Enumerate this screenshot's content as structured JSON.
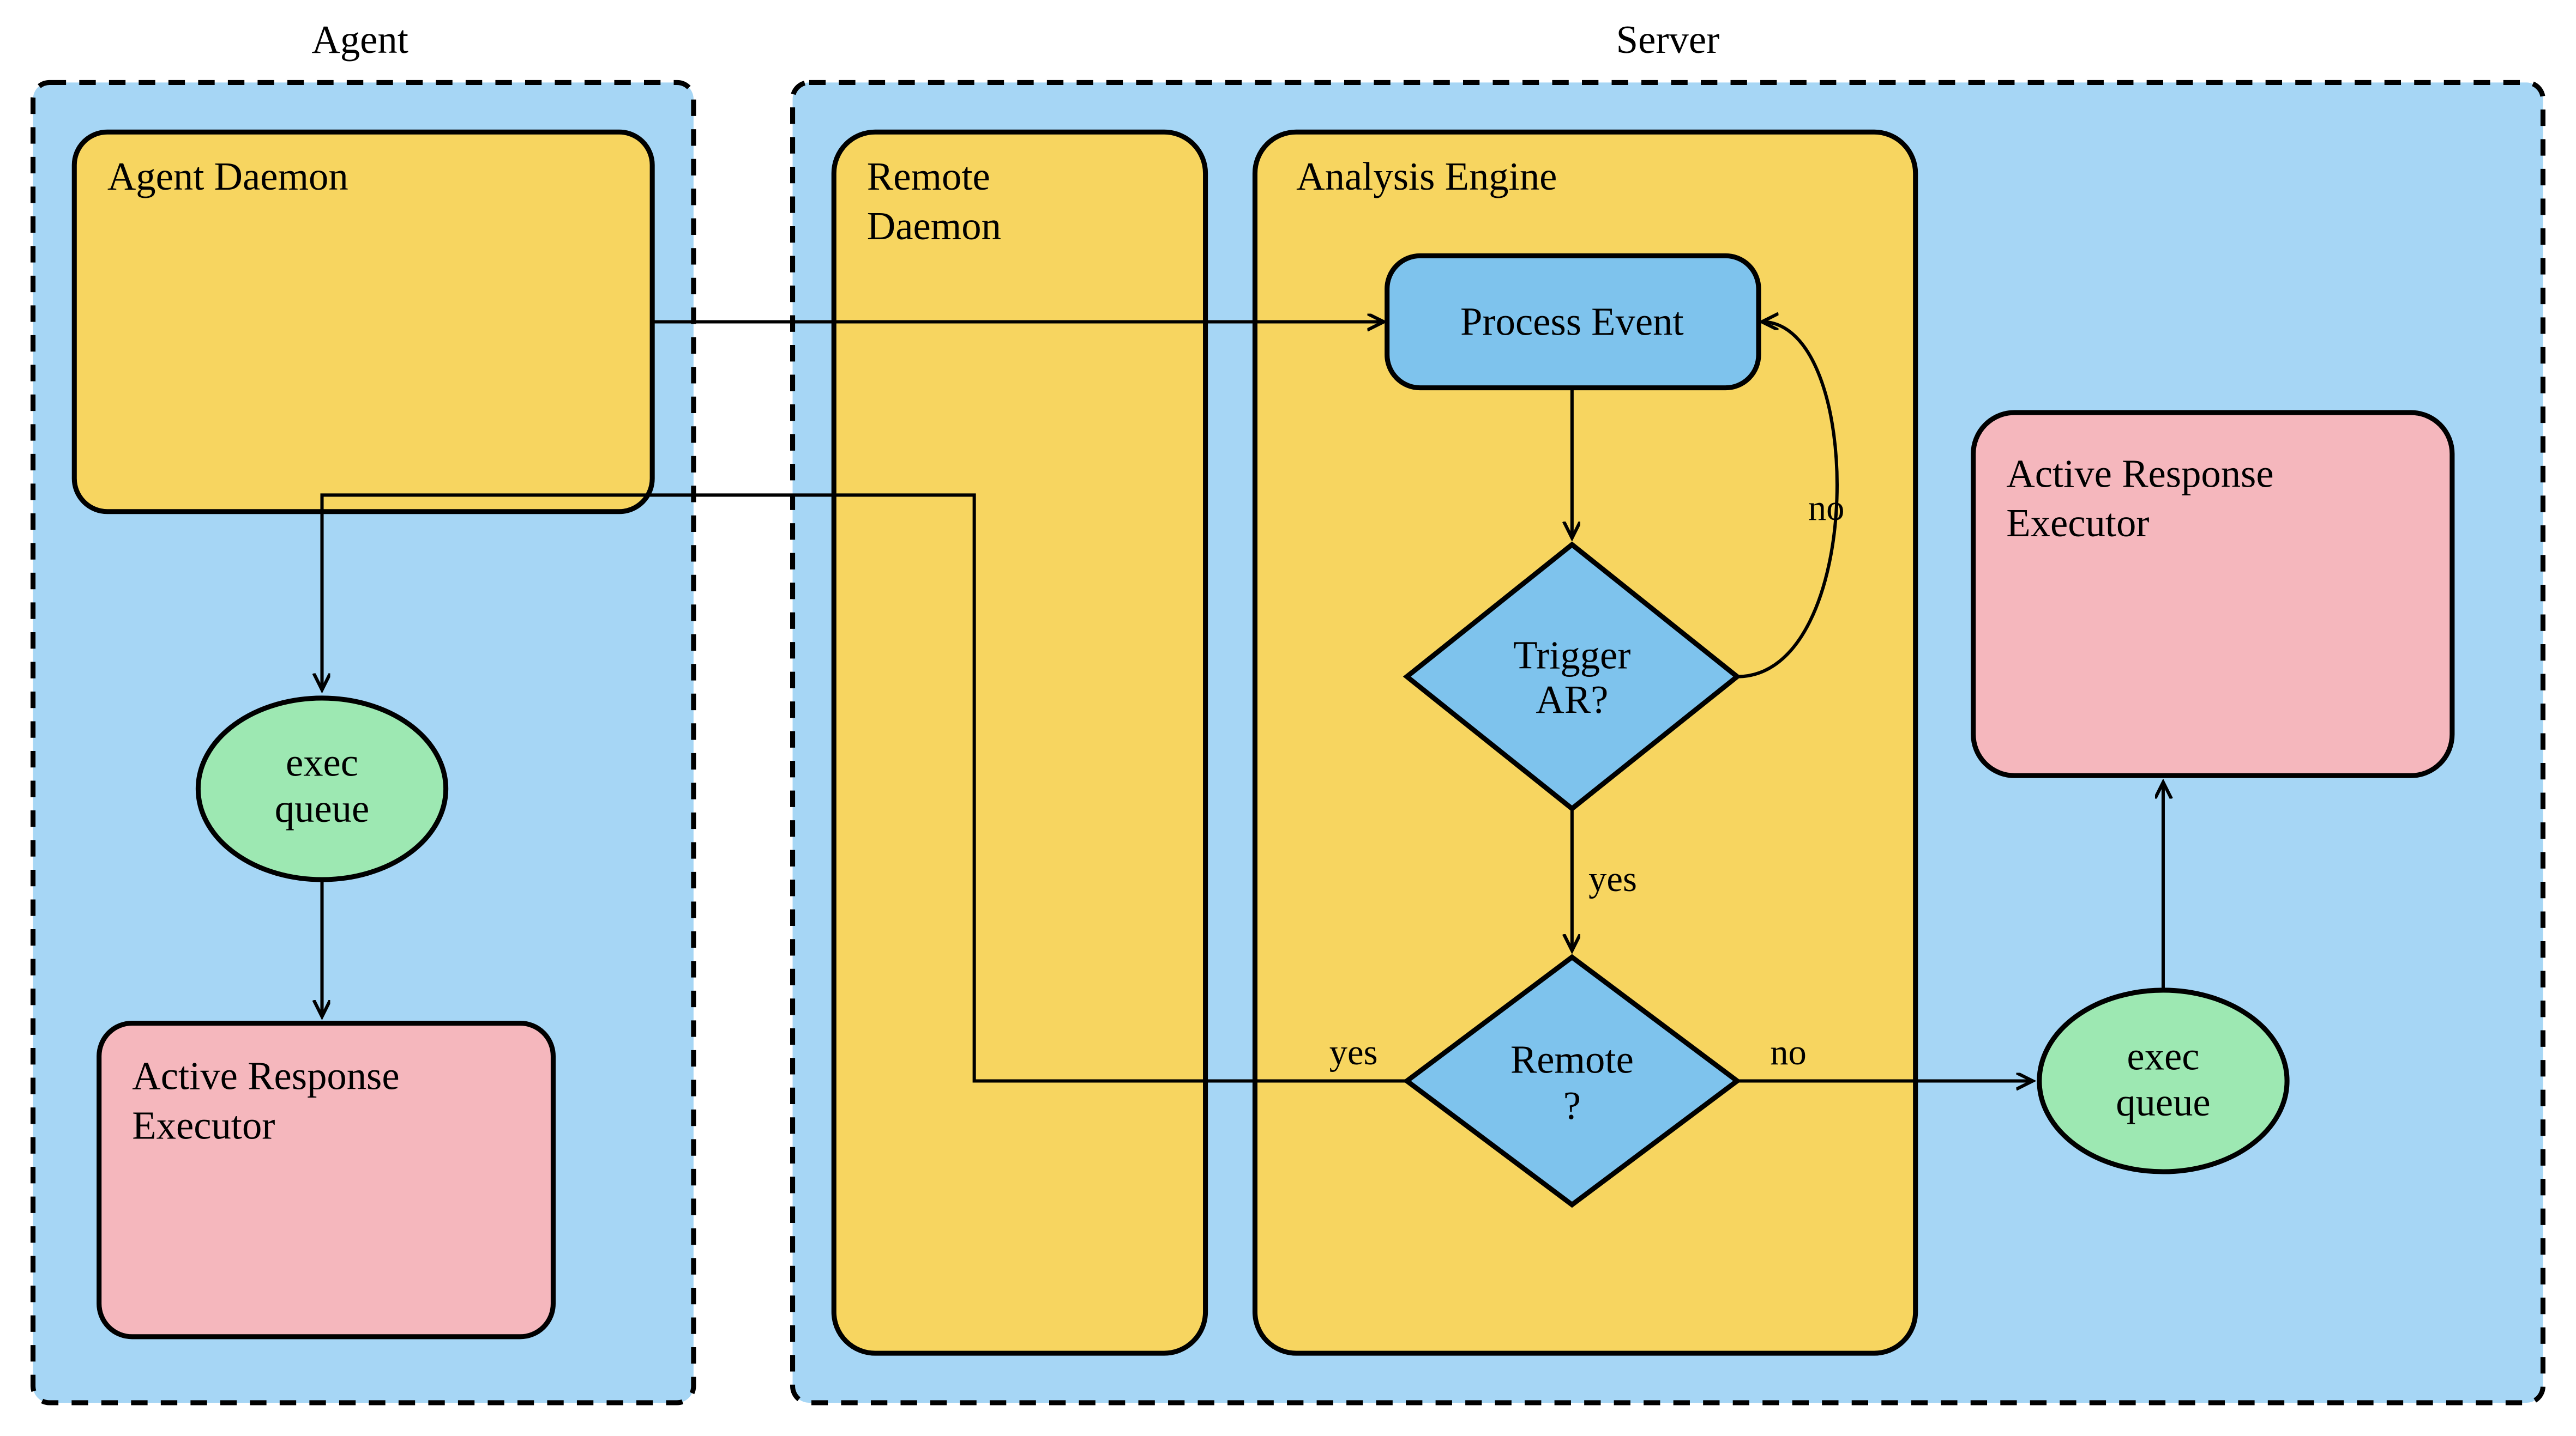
{
  "diagram": {
    "groups": {
      "agent": {
        "title": "Agent"
      },
      "server": {
        "title": "Server"
      }
    },
    "nodes": {
      "agent_daemon": {
        "label": "Agent Daemon"
      },
      "agent_exec_queue": {
        "line1": "exec",
        "line2": "queue"
      },
      "agent_ar_executor": {
        "line1": "Active Response",
        "line2": "Executor"
      },
      "remote_daemon": {
        "line1": "Remote",
        "line2": "Daemon"
      },
      "analysis_engine": {
        "label": "Analysis Engine"
      },
      "process_event": {
        "label": "Process Event"
      },
      "trigger_ar": {
        "line1": "Trigger",
        "line2": "AR?"
      },
      "remote_q": {
        "line1": "Remote",
        "line2": "?"
      },
      "server_exec_queue": {
        "line1": "exec",
        "line2": "queue"
      },
      "server_ar_executor": {
        "line1": "Active Response",
        "line2": "Executor"
      }
    },
    "edges": {
      "trigger_yes": "yes",
      "trigger_no": "no",
      "remote_yes": "yes",
      "remote_no": "no"
    }
  }
}
